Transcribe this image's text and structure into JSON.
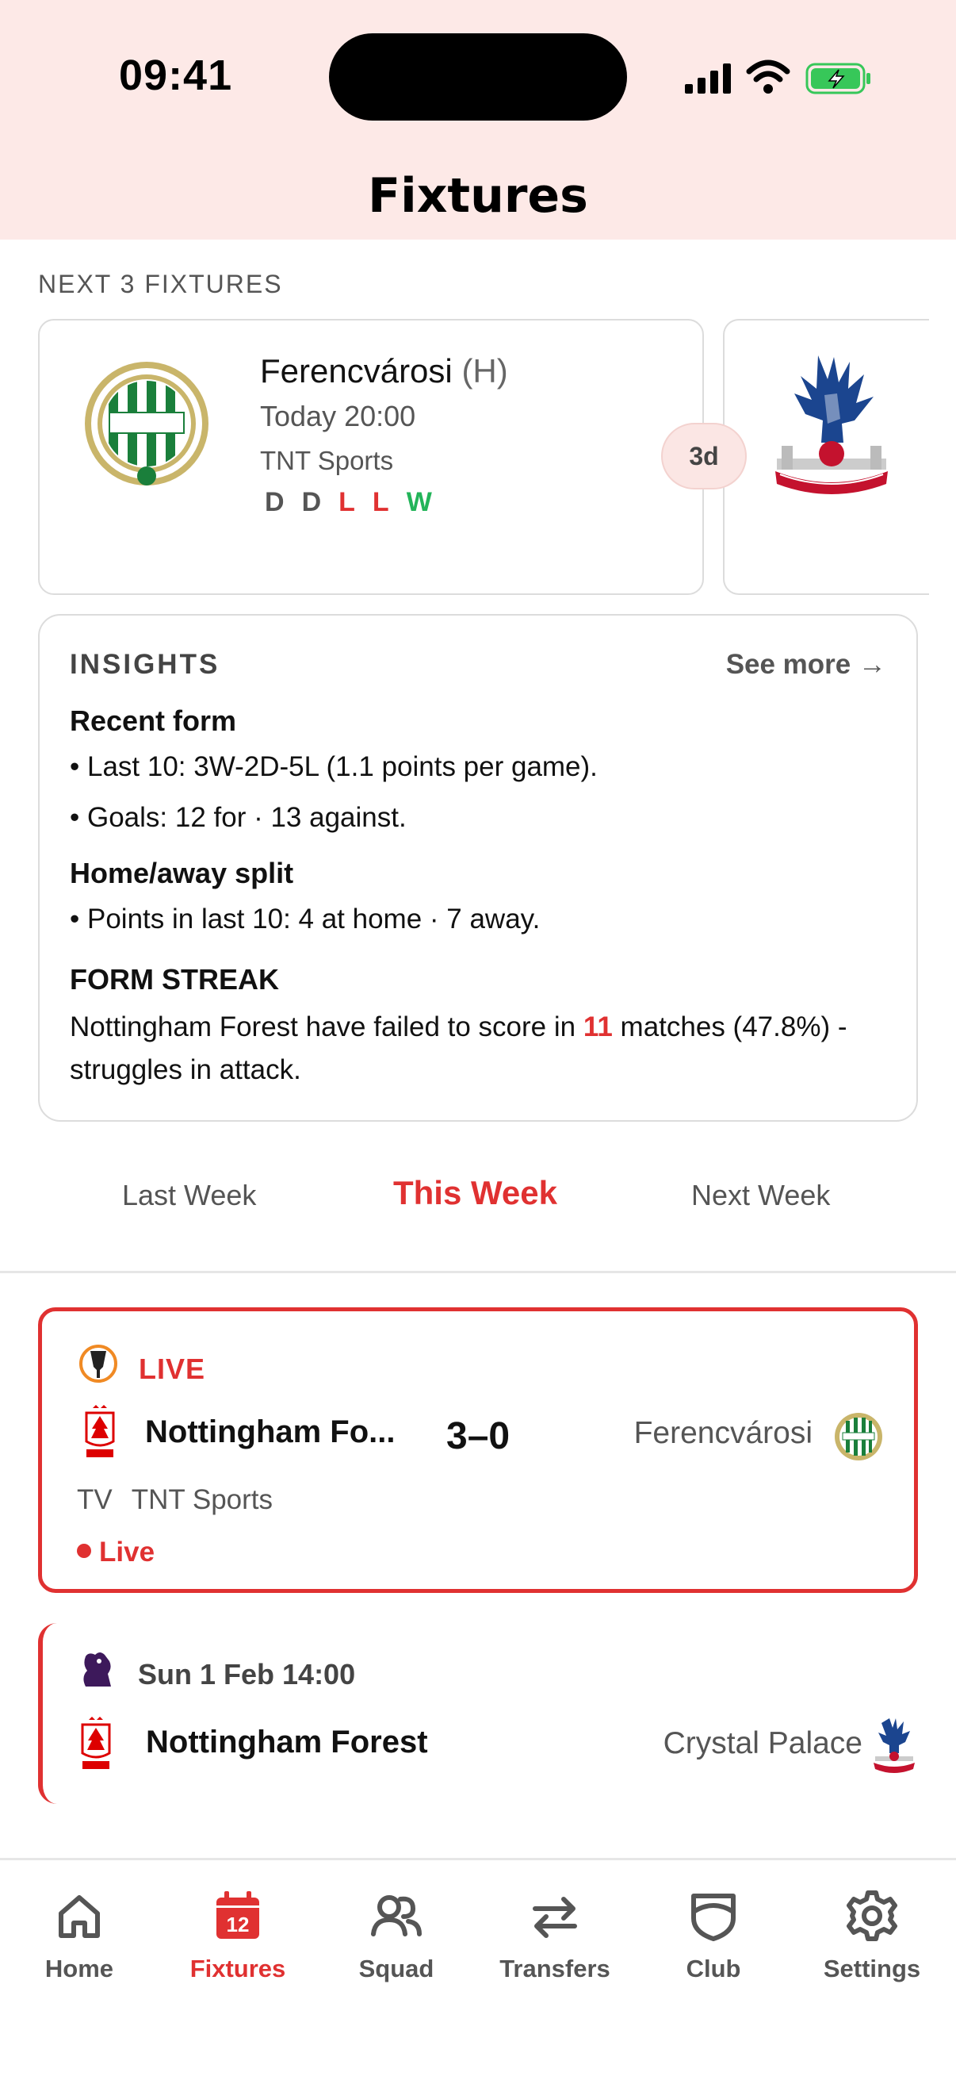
{
  "status_bar": {
    "time": "09:41"
  },
  "header": {
    "title": "Fixtures"
  },
  "next_fixtures": {
    "label": "NEXT 3 FIXTURES",
    "cards": [
      {
        "opponent": "Ferencvárosi",
        "venue": "(H)",
        "datetime": "Today 20:00",
        "tv": "TNT Sports",
        "form": [
          "D",
          "D",
          "L",
          "L",
          "W"
        ]
      }
    ],
    "next_countdown": "3d"
  },
  "insights": {
    "title": "INSIGHTS",
    "see_more": "See more →",
    "recent_form_heading": "Recent form",
    "recent_form_1": "• Last 10: 3W-2D-5L (1.1 points per game).",
    "recent_form_2": "• Goals: 12 for · 13 against.",
    "split_heading": "Home/away split",
    "split_1": "• Points in last 10: 4 at home · 7 away.",
    "streak_heading": "FORM STREAK",
    "streak_pre": "Nottingham Forest have failed to score in ",
    "streak_num": "11",
    "streak_post": " matches (47.8%) - struggles in attack."
  },
  "week_tabs": {
    "last": "Last Week",
    "this": "This Week",
    "next": "Next Week"
  },
  "live_match": {
    "status": "LIVE",
    "home": "Nottingham Fo...",
    "score": "3–0",
    "away": "Ferencvárosi",
    "tv_label": "TV",
    "tv": "TNT Sports",
    "live_text": "Live"
  },
  "upcoming_match": {
    "date": "Sun 1 Feb 14:00",
    "home": "Nottingham Forest",
    "away": "Crystal Palace"
  },
  "nav": {
    "home": "Home",
    "fixtures": "Fixtures",
    "fixtures_day": "12",
    "squad": "Squad",
    "transfers": "Transfers",
    "club": "Club",
    "settings": "Settings"
  },
  "colors": {
    "accent": "#e03131",
    "header_bg": "#fde9e7",
    "win": "#22b459"
  }
}
